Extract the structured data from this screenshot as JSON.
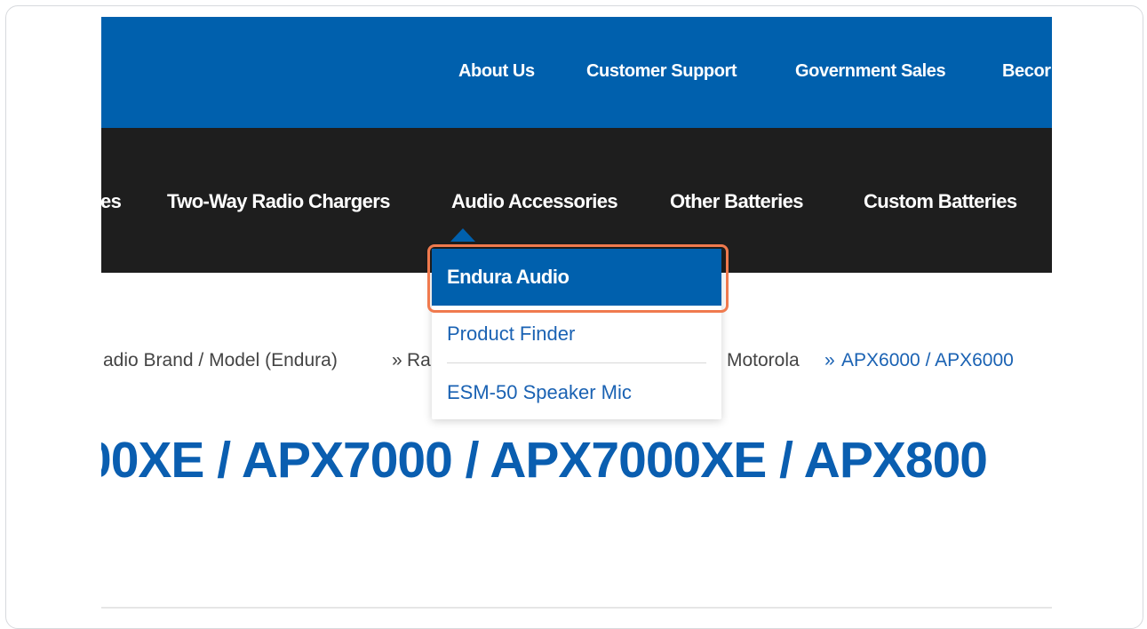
{
  "top_nav": {
    "items": [
      "About Us",
      "Customer Support",
      "Government Sales",
      "Becor"
    ]
  },
  "main_nav": {
    "items": [
      "es",
      "Two-Way Radio Chargers",
      "Audio Accessories",
      "Other Batteries",
      "Custom Batteries"
    ]
  },
  "dropdown": {
    "items": [
      "Endura Audio",
      "Product Finder",
      "ESM-50 Speaker Mic"
    ],
    "active_index": 0
  },
  "breadcrumb": {
    "part1": "adio Brand / Model (Endura)",
    "sep1": "»",
    "part2": "Ra",
    "part3": "Motorola",
    "sep2": "»",
    "part4": "APX6000 / APX6000"
  },
  "page": {
    "title": "00XE / APX7000 / APX7000XE / APX800"
  },
  "colors": {
    "topbar": "#0060ad",
    "mainbar": "#1e1e1e",
    "link": "#1a62b3",
    "highlight": "#f07a4e"
  }
}
